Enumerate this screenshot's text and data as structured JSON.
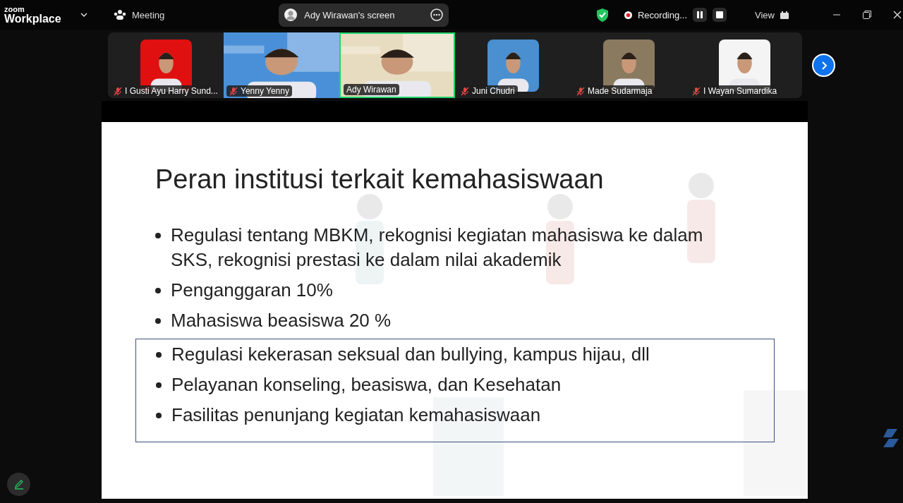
{
  "app": {
    "brand_top": "zoom",
    "brand_bottom": "Workplace"
  },
  "meeting_menu": {
    "label": "Meeting"
  },
  "share_pill": {
    "label": "Ady Wirawan's screen"
  },
  "recording": {
    "label": "Recording...",
    "paused": false
  },
  "view_menu": {
    "label": "View"
  },
  "participants": [
    {
      "name": "I Gusti Ayu Harry Sund...",
      "muted": true,
      "selected": false,
      "color": "#e01010"
    },
    {
      "name": "Yenny Yenny",
      "muted": true,
      "kind": "video",
      "selected": false,
      "color": "#4a90d9"
    },
    {
      "name": "Ady Wirawan",
      "muted": false,
      "kind": "video",
      "selected": true,
      "color": "#e8dcc0"
    },
    {
      "name": "Juni Chudri",
      "muted": true,
      "selected": false,
      "color": "#4a8fd0"
    },
    {
      "name": "Made Sudarmaja",
      "muted": true,
      "selected": false,
      "color": "#8a7a60"
    },
    {
      "name": "I Wayan Sumardika",
      "muted": true,
      "selected": false,
      "color": "#f4f4f4"
    }
  ],
  "slide": {
    "title": "Peran institusi terkait kemahasiswaan",
    "bullets": [
      {
        "text": "Regulasi tentang MBKM, rekognisi kegiatan mahasiswa ke dalam SKS, rekognisi prestasi ke dalam nilai akademik",
        "boxed": false
      },
      {
        "text": "Penganggaran 10%",
        "boxed": false
      },
      {
        "text": "Mahasiswa beasiswa 20 %",
        "boxed": false
      },
      {
        "text": "Regulasi kekerasan seksual dan bullying, kampus hijau, dll",
        "boxed": true
      },
      {
        "text": "Pelayanan konseling, beasiswa, dan Kesehatan",
        "boxed": true
      },
      {
        "text": "Fasilitas penunjang kegiatan kemahasiswaan",
        "boxed": true
      }
    ]
  }
}
